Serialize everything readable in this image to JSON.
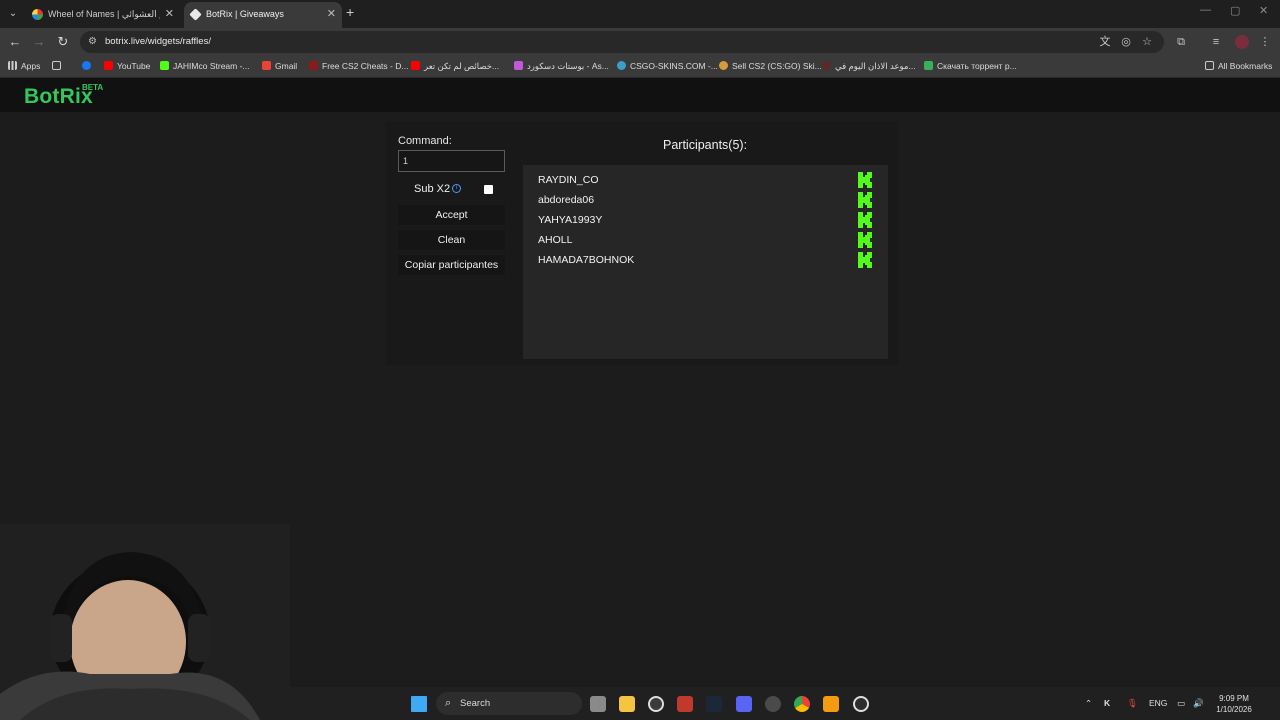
{
  "browser": {
    "tabs": [
      {
        "title": "Wheel of Names | سم العشوائي",
        "active": false
      },
      {
        "title": "BotRix | Giveaways",
        "active": true
      }
    ],
    "new_tab": "+",
    "url": "botrix.live/widgets/raffles/",
    "bookmarks": [
      {
        "label": "Apps",
        "color": "#e8e8e8"
      },
      {
        "label": "",
        "color": "#1877f2"
      },
      {
        "label": "YouTube",
        "color": "#ff0000"
      },
      {
        "label": "JAHIMco Stream -...",
        "color": "#53fc18"
      },
      {
        "label": "Gmail",
        "color": "#ea4335"
      },
      {
        "label": "Free CS2 Cheats - D...",
        "color": "#8b1a1a"
      },
      {
        "label": "خصائص لم تكن تعر...",
        "color": "#ff0000"
      },
      {
        "label": "بوستات دسكورد - As...",
        "color": "#c05ad8"
      },
      {
        "label": "CSGO-SKINS.COM -...",
        "color": "#3aa0c8"
      },
      {
        "label": "Sell CS2 (CS:GO) Ski...",
        "color": "#d89a3a"
      },
      {
        "label": "موعد الاذان اليوم في...",
        "color": "#5a2a2a"
      },
      {
        "label": "Скачать торрент р...",
        "color": "#3ab05a"
      }
    ],
    "all_bookmarks": "All Bookmarks"
  },
  "site": {
    "logo": "BotRix",
    "beta": "BETA",
    "command_label": "Command:",
    "command_value": "1",
    "sub_label": "Sub X2",
    "sub_checked": false,
    "buttons": {
      "accept": "Accept",
      "clean": "Clean",
      "copy": "Copiar participantes"
    },
    "participants_title": "Participants(5):",
    "participants": [
      "RAYDIN_CO",
      "abdoreda06",
      "YAHYA1993Y",
      "AHOLL",
      "HAMADA7BOHNOK"
    ],
    "accent_color": "#53fc18"
  },
  "taskbar": {
    "search": "Search",
    "lang": "ENG",
    "time": "9:09 PM",
    "date": "1/10/2026"
  }
}
